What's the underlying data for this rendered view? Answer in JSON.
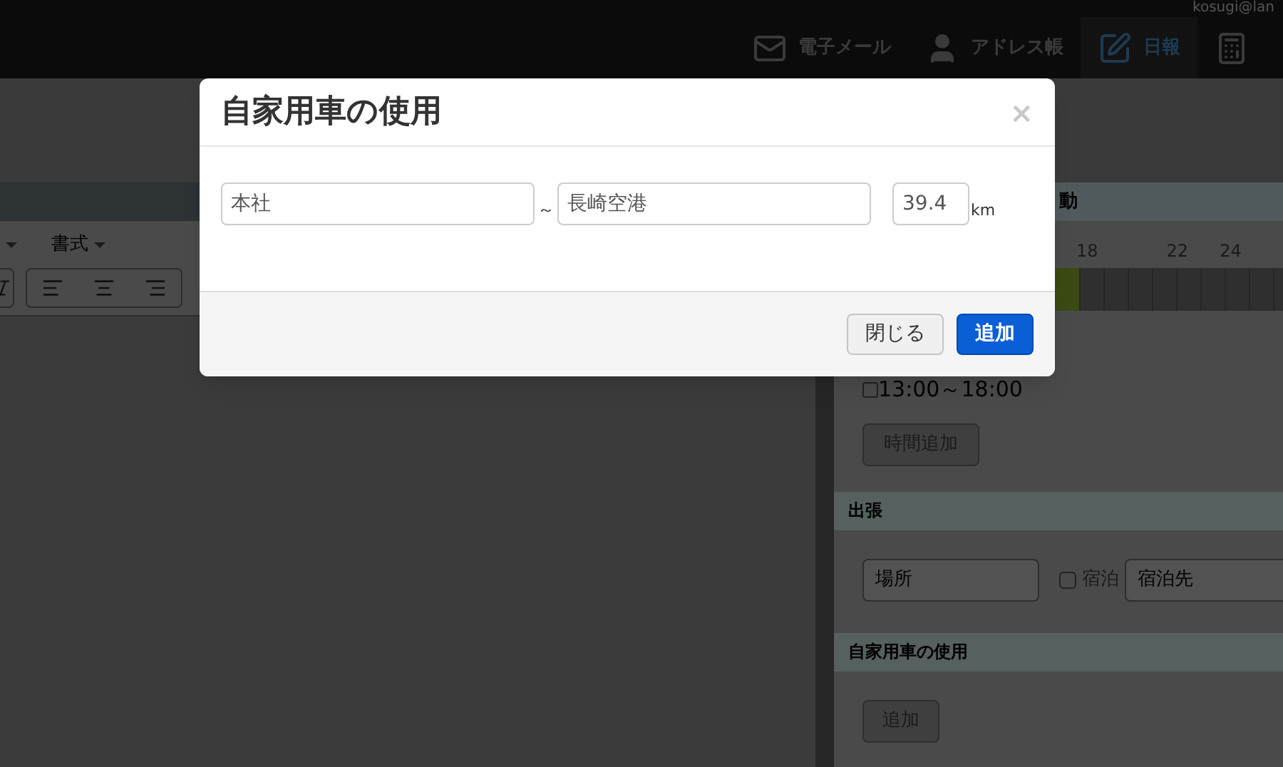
{
  "header": {
    "user": "kosugi@lan",
    "nav": [
      {
        "label": "電子メール",
        "kind": "mail",
        "selected": false
      },
      {
        "label": "アドレス帳",
        "kind": "person",
        "selected": false
      },
      {
        "label": "日報",
        "kind": "pen",
        "selected": true
      },
      {
        "kind": "calculator",
        "selected": false
      }
    ]
  },
  "editor": {
    "menus": [
      {
        "label": "書式"
      }
    ]
  },
  "right_panel": {
    "title_fragment": "動",
    "ticks": [
      "18",
      "22",
      "24"
    ],
    "time_slots": [
      {
        "label": "13:00～18:00",
        "checked": false
      }
    ],
    "add_time_button": "時間追加",
    "trip": {
      "title": "出張",
      "place_placeholder": "場所",
      "stay": {
        "label": "宿泊",
        "checked": false
      },
      "stay_place_placeholder": "宿泊先"
    },
    "car": {
      "title": "自家用車の使用",
      "add_button": "追加"
    }
  },
  "modal": {
    "title": "自家用車の使用",
    "close": "×",
    "from": "本社",
    "separator": "～",
    "to": "長崎空港",
    "distance": "39.4",
    "unit": "km",
    "buttons": [
      {
        "label": "閉じる",
        "kind": "default"
      },
      {
        "label": "追加",
        "kind": "primary"
      }
    ]
  }
}
